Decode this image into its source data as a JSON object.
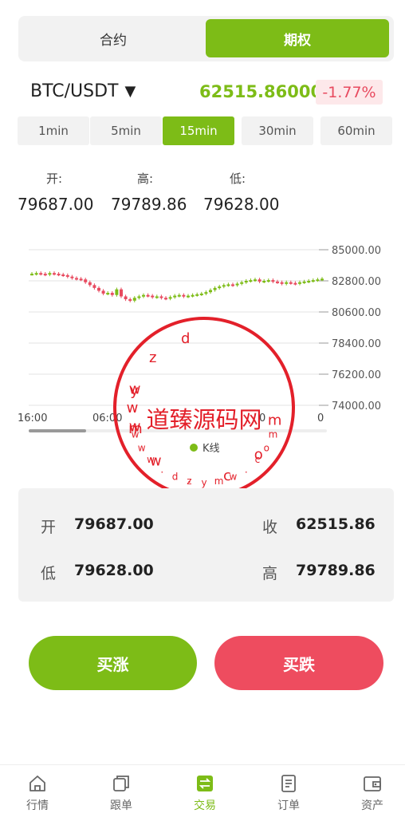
{
  "mode_tabs": [
    {
      "label": "合约",
      "active": false
    },
    {
      "label": "期权",
      "active": true
    }
  ],
  "symbol": {
    "pair": "BTC/USDT",
    "caret": "▼",
    "price": "62515.86000",
    "change": "-1.77%"
  },
  "periods": [
    {
      "label": "1min",
      "active": false
    },
    {
      "label": "5min",
      "active": false
    },
    {
      "label": "15min",
      "active": true
    },
    {
      "label": "30min",
      "active": false
    },
    {
      "label": "60min",
      "active": false
    }
  ],
  "ohl": {
    "open_label": "开:",
    "open_value": "79687.00",
    "high_label": "高:",
    "high_value": "79789.86",
    "low_label": "低:",
    "low_value": "79628.00"
  },
  "chart_data": {
    "type": "candlestick",
    "y_ticks": [
      "85000.00",
      "82800.00",
      "80600.00",
      "78400.00",
      "76200.00",
      "74000.00"
    ],
    "ylim": [
      74000,
      85000
    ],
    "x_ticks": [
      "16:00",
      "06:00",
      "0",
      "0"
    ],
    "legend": "K线",
    "series_color_up": "#7dbc17",
    "series_color_down": "#e84a5f",
    "closes": [
      83300,
      83350,
      83300,
      83250,
      83350,
      83300,
      83250,
      83200,
      83100,
      83000,
      82950,
      82900,
      82700,
      82500,
      82300,
      82100,
      81900,
      81950,
      81800,
      82200,
      81700,
      81500,
      81400,
      81600,
      81700,
      81800,
      81750,
      81650,
      81700,
      81600,
      81550,
      81650,
      81750,
      81800,
      81700,
      81750,
      81800,
      81850,
      81900,
      82000,
      82150,
      82300,
      82400,
      82500,
      82550,
      82500,
      82600,
      82700,
      82800,
      82850,
      82900,
      82750,
      82800,
      82850,
      82750,
      82700,
      82600,
      82700,
      82650,
      82600,
      82700,
      82750,
      82800,
      82850,
      82900,
      82950
    ]
  },
  "watermark": {
    "text": "道臻源码网",
    "letters_top": "dzymw.com",
    "www_left": "www",
    "letters_bottom": "www.dzymw.com"
  },
  "summary": {
    "open_label": "开",
    "open_value": "79687.00",
    "close_label": "收",
    "close_value": "62515.86",
    "low_label": "低",
    "low_value": "79628.00",
    "high_label": "高",
    "high_value": "79789.86"
  },
  "actions": {
    "buy_up": "买涨",
    "buy_down": "买跌"
  },
  "nav": [
    {
      "label": "行情",
      "icon": "home-icon",
      "active": false
    },
    {
      "label": "跟单",
      "icon": "copy-icon",
      "active": false
    },
    {
      "label": "交易",
      "icon": "exchange-icon",
      "active": true
    },
    {
      "label": "订单",
      "icon": "order-icon",
      "active": false
    },
    {
      "label": "资产",
      "icon": "wallet-icon",
      "active": false
    }
  ],
  "colors": {
    "accent": "#7dbc17",
    "danger": "#ee4c5f",
    "stamp": "#e3202a"
  }
}
